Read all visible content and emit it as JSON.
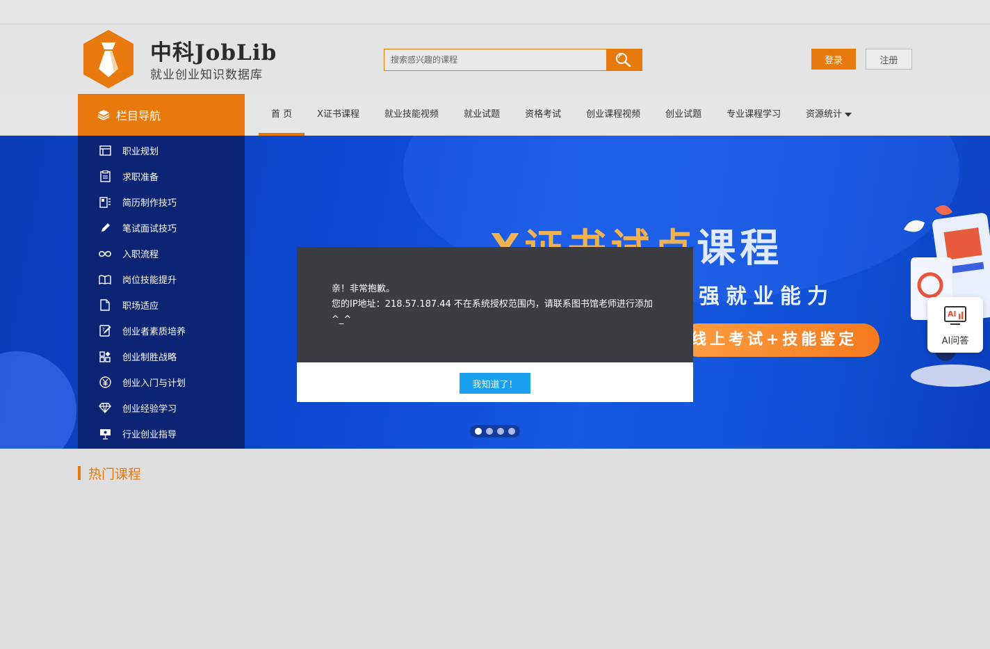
{
  "brand": {
    "title": "中科JobLib",
    "subtitle": "就业创业知识数据库",
    "logo_color": "#e8790c"
  },
  "search": {
    "placeholder": "搜索感兴趣的课程",
    "button_icon": "search-icon"
  },
  "auth": {
    "login_label": "登录",
    "register_label": "注册"
  },
  "nav": {
    "side_title": "栏目导航",
    "side_icon": "layers-icon",
    "links": [
      {
        "label": "首 页",
        "active": true
      },
      {
        "label": "X证书课程"
      },
      {
        "label": "就业技能视频"
      },
      {
        "label": "就业试题"
      },
      {
        "label": "资格考试"
      },
      {
        "label": "创业课程视频"
      },
      {
        "label": "创业试题"
      },
      {
        "label": "专业课程学习"
      },
      {
        "label": "资源统计",
        "dropdown": true
      }
    ]
  },
  "side_menu": {
    "items": [
      {
        "label": "职业规划",
        "icon": "window-icon"
      },
      {
        "label": "求职准备",
        "icon": "clipboard-icon"
      },
      {
        "label": "简历制作技巧",
        "icon": "resume-icon"
      },
      {
        "label": "笔试面试技巧",
        "icon": "pencil-icon"
      },
      {
        "label": "入职流程",
        "icon": "infinity-icon"
      },
      {
        "label": "岗位技能提升",
        "icon": "book-icon"
      },
      {
        "label": "职场适应",
        "icon": "document-icon"
      },
      {
        "label": "创业者素质培养",
        "icon": "edit-doc-icon"
      },
      {
        "label": "创业制胜战略",
        "icon": "grid-icon"
      },
      {
        "label": "创业入门与计划",
        "icon": "yen-icon"
      },
      {
        "label": "创业经验学习",
        "icon": "diamond-icon"
      },
      {
        "label": "行业创业指导",
        "icon": "presentation-icon"
      }
    ]
  },
  "banner": {
    "headline_gold": "X证书试点",
    "headline_rest": "课程",
    "subline": "强就业能力",
    "pill_text": "线上考试+技能鉴定",
    "dots": [
      {
        "active": true
      },
      {},
      {},
      {}
    ]
  },
  "ai_widget": {
    "label": "AI问答",
    "icon": "ai-chart-icon",
    "icon_text": "AI"
  },
  "section": {
    "hot_courses_title": "热门课程"
  },
  "modal": {
    "line1": "亲！非常抱歉。",
    "line2": "您的IP地址：218.57.187.44 不在系统授权范围内，请联系图书馆老师进行添加 ^_^",
    "ok_label": "我知道了！"
  },
  "colors": {
    "accent": "#e8790c",
    "menu_bg": "#0b2474",
    "modal_bg": "#3c3d43",
    "ok_button": "#1ba0f0"
  }
}
